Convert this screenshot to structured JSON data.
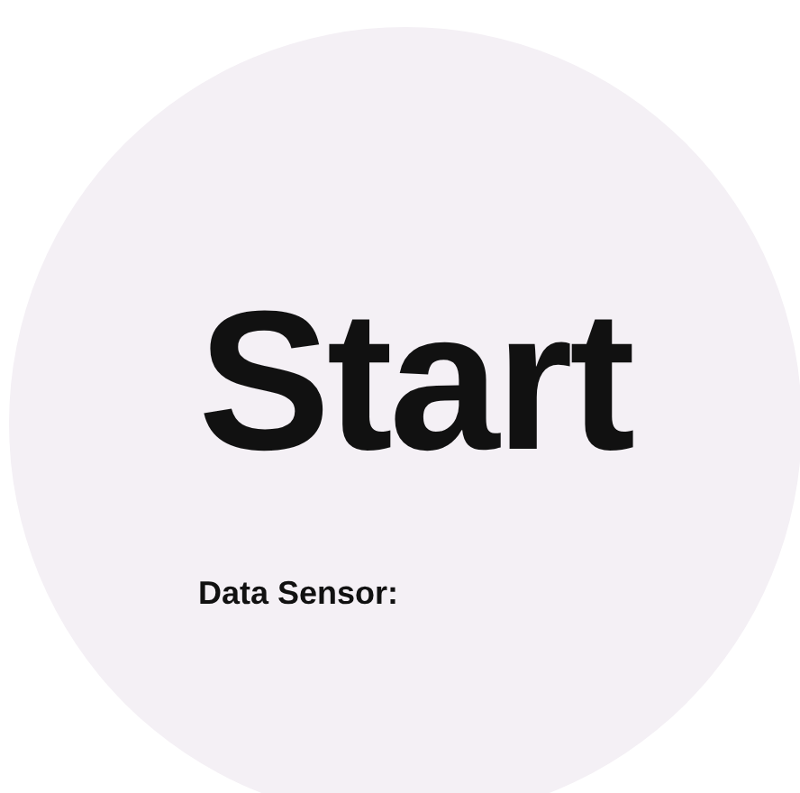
{
  "screen": {
    "title": "Start",
    "label": "Data Sensor:"
  }
}
